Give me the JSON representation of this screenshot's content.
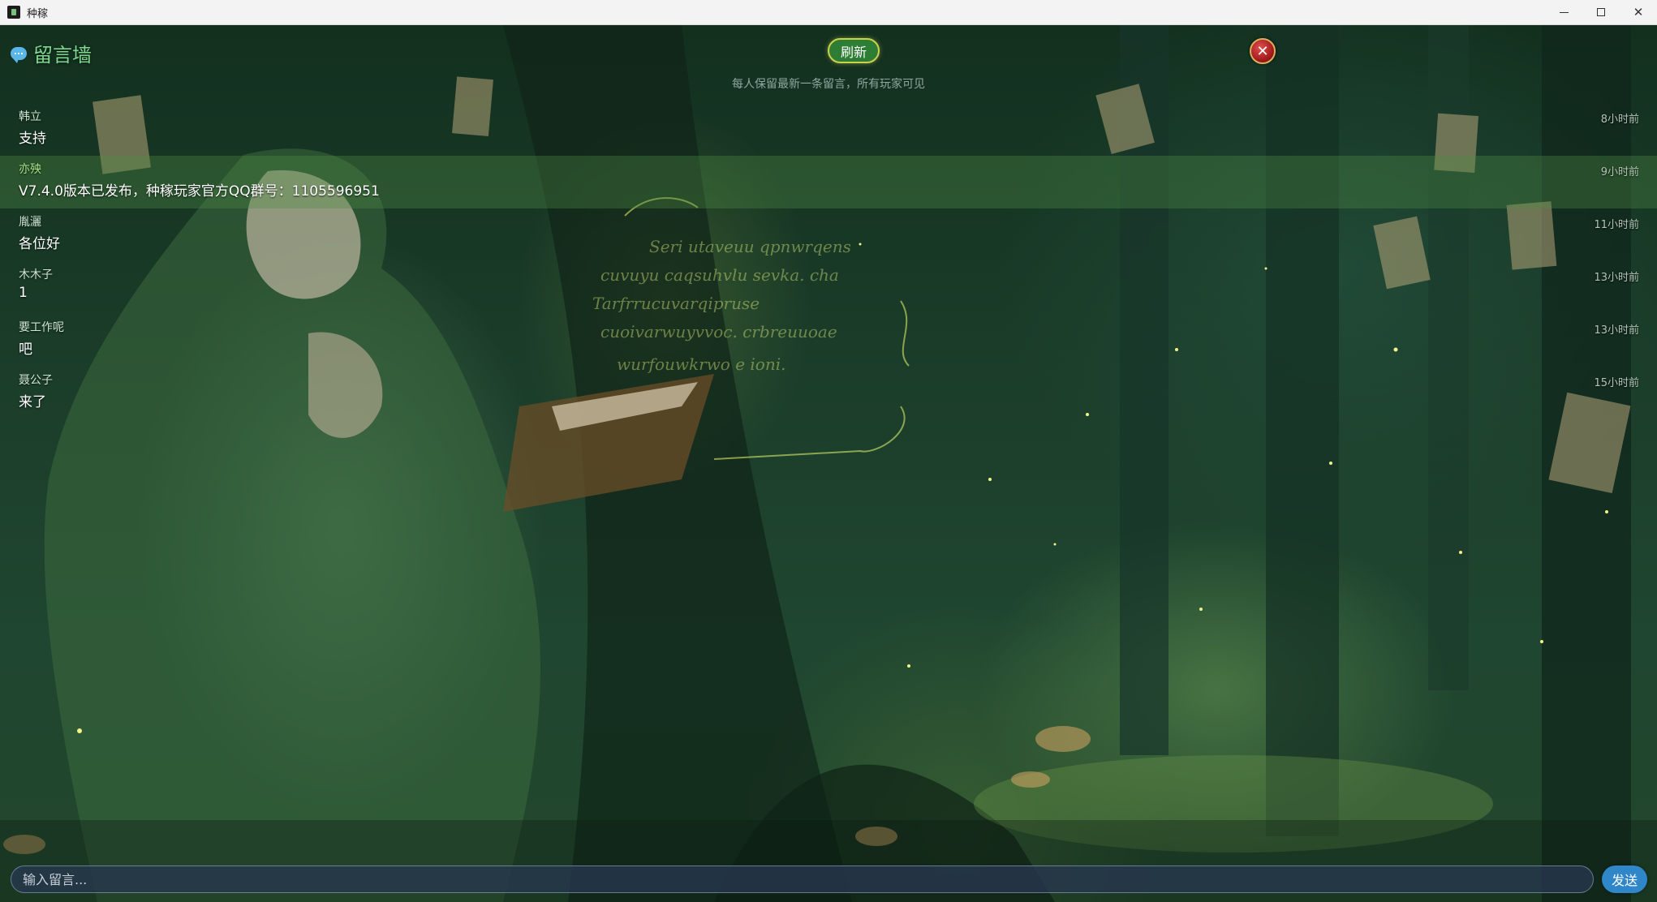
{
  "window": {
    "title": "种稼"
  },
  "panel": {
    "title": "留言墙",
    "refresh_label": "刷新",
    "hint": "每人保留最新一条留言，所有玩家可见",
    "close_label": "✕"
  },
  "messages": [
    {
      "name": "韩立",
      "text": "支持",
      "time": "8小时前",
      "highlight": false
    },
    {
      "name": "亦殃",
      "text": "V7.4.0版本已发布，种稼玩家官方QQ群号：1105596951",
      "time": "9小时前",
      "highlight": true
    },
    {
      "name": "胤灑",
      "text": "各位好",
      "time": "11小时前",
      "highlight": false
    },
    {
      "name": "木木子",
      "text": "1",
      "time": "13小时前",
      "highlight": false
    },
    {
      "name": "要工作呢",
      "text": "吧",
      "time": "13小时前",
      "highlight": false
    },
    {
      "name": "聂公子",
      "text": "来了",
      "time": "15小时前",
      "highlight": false
    }
  ],
  "composer": {
    "placeholder": "输入留言...",
    "send_label": "发送"
  },
  "colors": {
    "accent": "#7fd88f",
    "refresh_bg": "#2e7d34",
    "send_bg": "#2f86c9",
    "close_bg": "#a11818"
  },
  "icons": {
    "title_icon": "chat-bubble-icon",
    "close_icon": "close-x-icon"
  }
}
